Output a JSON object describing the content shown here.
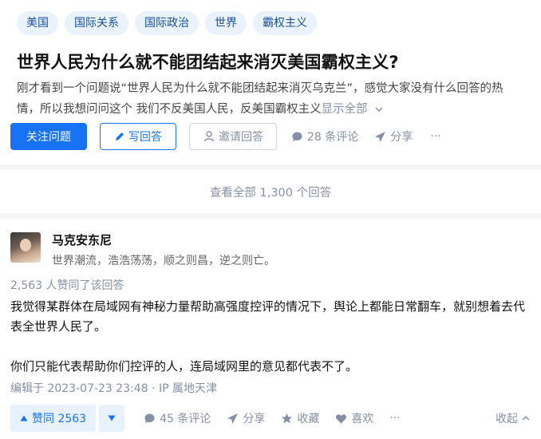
{
  "question": {
    "tags": [
      "美国",
      "国际关系",
      "国际政治",
      "世界",
      "霸权主义"
    ],
    "title": "世界人民为什么就不能团结起来消灭美国霸权主义?",
    "detail_line1": "刚才看到一个问题说“世界人民为什么就不能团结起来消灭乌克兰”，感觉大家没有什么回答的热",
    "detail_line2": "情，所以我想问问这个 我们不反美国人民，反美国霸权主义",
    "show_all": "显示全部",
    "follow_label": "关注问题",
    "write_label": "写回答",
    "invite_label": "邀请回答",
    "comments_label": "28 条评论",
    "share_label": "分享",
    "more_label": "···"
  },
  "summary": {
    "view_all": "查看全部 1,300 个回答"
  },
  "answer": {
    "author_name": "马克安东尼",
    "author_bio": "世界潮流，浩浩荡荡，顺之则昌，逆之则亡。",
    "agree_text": "2,563 人赞同了该回答",
    "paragraph1": "我觉得某群体在局域网有神秘力量帮助高强度控评的情况下，舆论上都能日常翻车，就别想着去代表全世界人民了。",
    "paragraph2": "你们只能代表帮助你们控评的人，连局域网里的意见都代表不了。",
    "edit_info": "编辑于 2023-07-23 23:48 · IP 属地天津",
    "upvote_label": "赞同 2563",
    "comments_label": "45 条评论",
    "share_label": "分享",
    "collect_label": "收藏",
    "like_label": "喜欢",
    "more_label": "···",
    "collapse_label": "收起"
  }
}
